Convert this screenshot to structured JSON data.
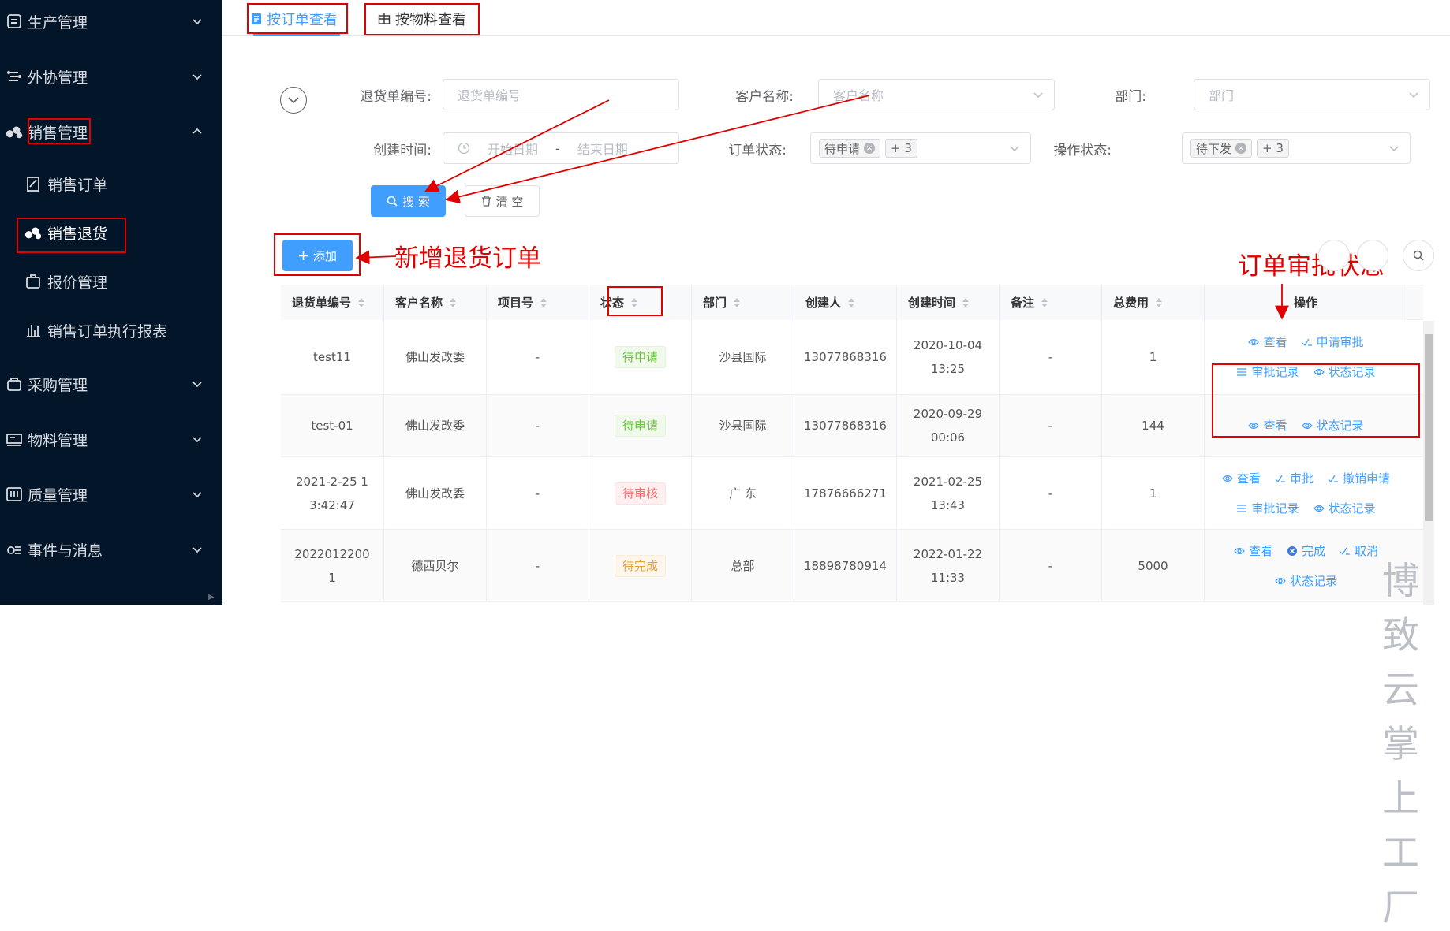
{
  "sidebar": {
    "items": [
      {
        "label": "生产管理",
        "icon": "production-icon"
      },
      {
        "label": "外协管理",
        "icon": "outsource-icon"
      },
      {
        "label": "销售管理",
        "icon": "sales-icon"
      },
      {
        "label": "销售订单",
        "icon": "sales-order-icon"
      },
      {
        "label": "销售退货",
        "icon": "sales-return-icon"
      },
      {
        "label": "报价管理",
        "icon": "quote-icon"
      },
      {
        "label": "销售订单执行报表",
        "icon": "report-icon"
      },
      {
        "label": "采购管理",
        "icon": "purchase-icon"
      },
      {
        "label": "物料管理",
        "icon": "material-icon"
      },
      {
        "label": "质量管理",
        "icon": "quality-icon"
      },
      {
        "label": "事件与消息",
        "icon": "event-icon"
      }
    ]
  },
  "tabs": [
    {
      "label": "按订单查看"
    },
    {
      "label": "按物料查看"
    }
  ],
  "filters": {
    "return_no": {
      "label": "退货单编号:",
      "placeholder": "退货单编号"
    },
    "customer": {
      "label": "客户名称:",
      "placeholder": "客户名称"
    },
    "department": {
      "label": "部门:",
      "placeholder": "部门"
    },
    "created_time": {
      "label": "创建时间:",
      "start": "开始日期",
      "sep": "-",
      "end": "结束日期"
    },
    "order_status": {
      "label": "订单状态:",
      "tag": "待申请",
      "more": "+ 3"
    },
    "op_status": {
      "label": "操作状态:",
      "tag": "待下发",
      "more": "+ 3"
    }
  },
  "buttons": {
    "search": "搜 索",
    "clear": "清 空",
    "add": "添加"
  },
  "annotations": {
    "new_return": "新增退货订单",
    "approval_status": "订单审批状态"
  },
  "table": {
    "headers": [
      "退货单编号",
      "客户名称",
      "项目号",
      "状态",
      "部门",
      "创建人",
      "创建时间",
      "备注",
      "总费用",
      "操作"
    ],
    "rows": [
      {
        "no": "test11",
        "customer": "佛山发改委",
        "project": "-",
        "status": "待申请",
        "dept": "沙县国际",
        "creator": "13077868316",
        "time": "2020-10-04 13:25",
        "remark": "-",
        "cost": "1",
        "ops": [
          "查看",
          "申请审批",
          "审批记录",
          "状态记录"
        ]
      },
      {
        "no": "test-01",
        "customer": "佛山发改委",
        "project": "-",
        "status": "待申请",
        "dept": "沙县国际",
        "creator": "13077868316",
        "time": "2020-09-29 00:06",
        "remark": "-",
        "cost": "144",
        "ops": [
          "查看",
          "状态记录"
        ]
      },
      {
        "no": "2021-2-25 13:42:47",
        "customer": "佛山发改委",
        "project": "-",
        "status": "待审核",
        "dept": "广 东",
        "creator": "17876666271",
        "time": "2021-02-25 13:43",
        "remark": "-",
        "cost": "1",
        "ops": [
          "查看",
          "审批",
          "撤销申请",
          "审批记录",
          "状态记录"
        ]
      },
      {
        "no": "20220122001",
        "customer": "德西贝尔",
        "project": "-",
        "status": "待完成",
        "dept": "总部",
        "creator": "18898780914",
        "time": "2022-01-22 11:33",
        "remark": "-",
        "cost": "5000",
        "ops": [
          "查看",
          "完成",
          "取消",
          "状态记录"
        ]
      }
    ]
  },
  "watermark": "博致云掌上工厂",
  "colors": {
    "sidebar_bg": "#031529",
    "primary": "#409eff",
    "annotation_red": "#e00000"
  }
}
